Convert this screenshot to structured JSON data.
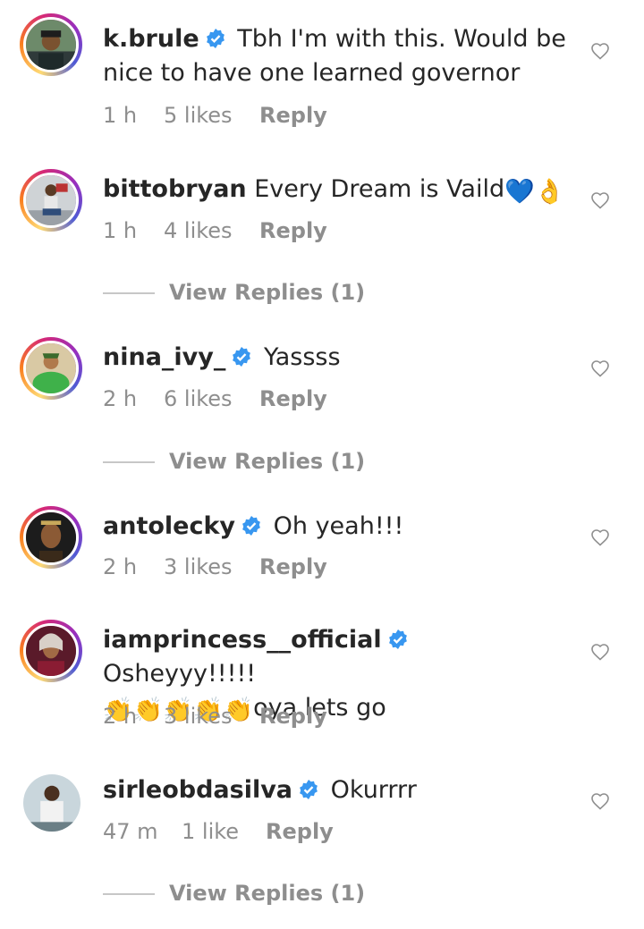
{
  "comments": [
    {
      "username": "k.brule",
      "verified": true,
      "text": "Tbh I'm with this. Would be nice to have one learned governor",
      "time": "1 h",
      "likes": "5 likes",
      "reply": "Reply"
    },
    {
      "username": "bittobryan",
      "verified": false,
      "text": "Every Dream is Vaild",
      "emoji": "💙👌",
      "time": "1 h",
      "likes": "4 likes",
      "reply": "Reply",
      "view_replies": "View Replies (1)"
    },
    {
      "username": "nina_ivy_",
      "verified": true,
      "text": "Yassss",
      "time": "2 h",
      "likes": "6 likes",
      "reply": "Reply",
      "view_replies": "View Replies (1)"
    },
    {
      "username": "antolecky",
      "verified": true,
      "text": "Oh yeah!!!",
      "time": "2 h",
      "likes": "3 likes",
      "reply": "Reply"
    },
    {
      "username": "iamprincess__official",
      "verified": true,
      "text": "Osheyyy!!!!!",
      "text2": "👏👏👏👏👏",
      "text3": "oya lets go",
      "time": "2 h",
      "likes": "3 likes",
      "reply": "Reply"
    },
    {
      "username": "sirleobdasilva",
      "verified": true,
      "text": "Okurrrr",
      "time": "47 m",
      "likes": "1 like",
      "reply": "Reply",
      "view_replies": "View Replies (1)"
    }
  ],
  "colors": {
    "verified": "#3897f0",
    "secondary": "#8e8e8e",
    "primary": "#262626"
  }
}
